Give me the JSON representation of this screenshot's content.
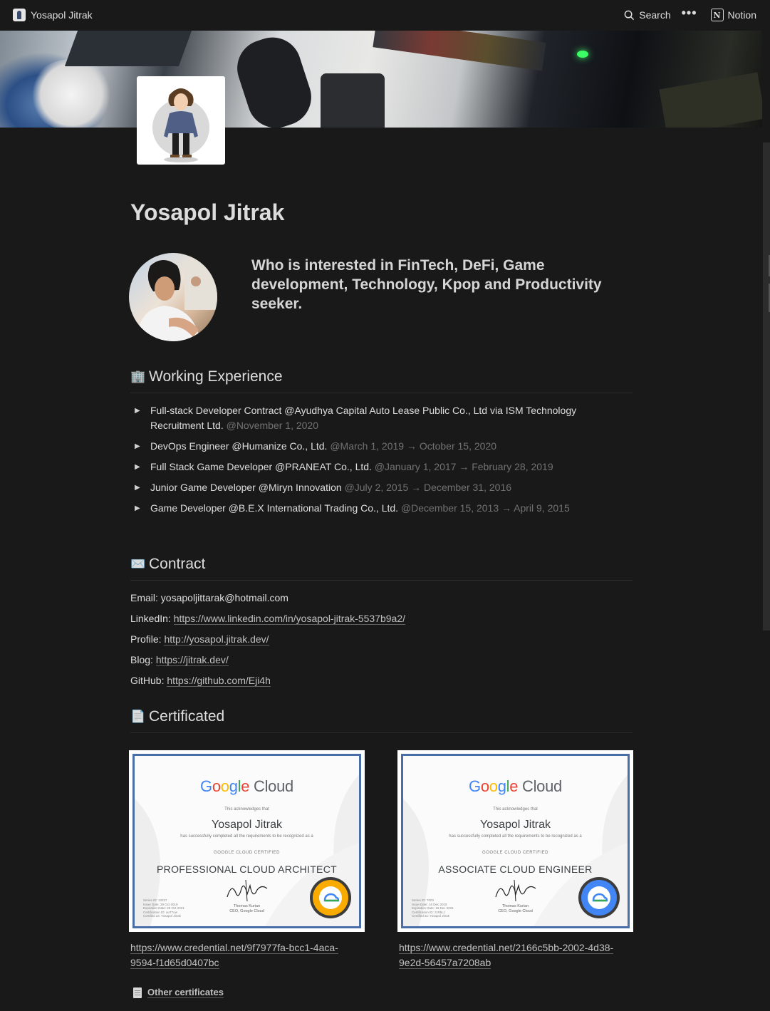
{
  "topbar": {
    "page_title": "Yosapol Jitrak",
    "search_label": "Search",
    "more_icon": "…",
    "notion_label": "Notion"
  },
  "page": {
    "title": "Yosapol Jitrak",
    "tagline": "Who is interested in FinTech, DeFi, Game development, Technology, Kpop and Productivity seeker."
  },
  "experience": {
    "icon": "🏢",
    "heading": "Working Experience",
    "items": [
      {
        "title": "Full-stack Developer Contract @Ayudhya Capital Auto Lease Public Co., Ltd via ISM Technology Recruitment Ltd.",
        "date": "@November 1, 2020"
      },
      {
        "title": "DevOps Engineer @Humanize Co., Ltd.",
        "date": "@March 1, 2019 → October 15, 2020"
      },
      {
        "title": "Full Stack Game Developer @PRANEAT Co., Ltd.",
        "date": "@January 1, 2017 → February 28, 2019"
      },
      {
        "title": "Junior Game Developer @Miryn Innovation",
        "date": "@July 2, 2015 → December 31, 2016"
      },
      {
        "title": "Game Developer @B.E.X International Trading Co., Ltd.",
        "date": "@December 15, 2013 → April 9, 2015"
      }
    ]
  },
  "contact": {
    "icon": "✉️",
    "heading": "Contract",
    "email_label": "Email:",
    "email": "yosapoljittarak@hotmail.com",
    "linkedin_label": "LinkedIn:",
    "linkedin": "https://www.linkedin.com/in/yosapol-jitrak-5537b9a2/",
    "profile_label": "Profile:",
    "profile": "http://yosapol.jitrak.dev/",
    "blog_label": "Blog:",
    "blog": "https://jitrak.dev/",
    "github_label": "GitHub:",
    "github": "https://github.com/Eji4h"
  },
  "certificates": {
    "icon": "📄",
    "heading": "Certificated",
    "items": [
      {
        "brand": "Google Cloud",
        "acknowledges": "This acknowledges that",
        "name": "Yosapol Jitrak",
        "completed": "has successfully completed all the requirements to be recognized as a",
        "certified": "GOOGLE CLOUD CERTIFIED",
        "role": "PROFESSIONAL CLOUD ARCHITECT",
        "ceo_name": "Thomas Kurian",
        "ceo_title": "CEO, Google Cloud",
        "meta": [
          "Series ID: 12237",
          "Issue Date: 29 Oct 2019",
          "Expiration Date: 29 Oct 2021",
          "Certification ID: auT7ow",
          "Certified as: Yosapol Jitrak"
        ],
        "link": "https://www.credential.net/9f7977fa-bcc1-4aca-9594-f1d65d0407bc"
      },
      {
        "brand": "Google Cloud",
        "acknowledges": "This acknowledges that",
        "name": "Yosapol Jitrak",
        "completed": "has successfully completed all the requirements to be recognized as a",
        "certified": "GOOGLE CLOUD CERTIFIED",
        "role": "ASSOCIATE CLOUD ENGINEER",
        "ceo_name": "Thomas Kurian",
        "ceo_title": "CEO, Google Cloud",
        "meta": [
          "Series ID: 7003",
          "Issue Date: 16 Dec 2019",
          "Expiration Date: 16 Dec 2021",
          "Certification ID: zzRbLz",
          "Certified as: Yosapol Jitrak"
        ],
        "link": "https://www.credential.net/2166c5bb-2002-4d38-9e2d-56457a7208ab"
      }
    ],
    "other_label": "Other certificates"
  }
}
